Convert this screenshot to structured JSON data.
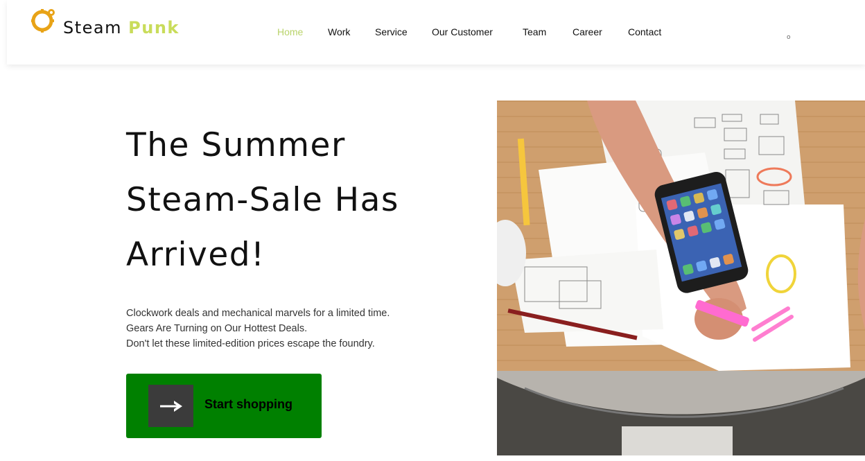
{
  "brand": {
    "name_part1": "Steam",
    "name_part2": "Punk",
    "logo_icon": "gear-icon",
    "accent_color": "#c9dc5a"
  },
  "nav": {
    "items": [
      {
        "label": "Home",
        "active": true
      },
      {
        "label": "Work",
        "active": false
      },
      {
        "label": "Service",
        "active": false
      },
      {
        "label": "Our Customer",
        "active": false
      },
      {
        "label": "Team",
        "active": false
      },
      {
        "label": "Career",
        "active": false
      },
      {
        "label": "Contact",
        "active": false
      }
    ],
    "active_color": "#b9d36a"
  },
  "header_extra": {
    "dot": "o"
  },
  "hero": {
    "title_lines": [
      "The Summer",
      "Steam-Sale Has",
      "Arrived!"
    ],
    "subtitle_lines": [
      "Clockwork deals and mechanical marvels for a limited time.",
      "Gears Are Turning on Our Hottest Deals.",
      "Don't let these limited-edition prices escape the foundry."
    ],
    "cta": {
      "label": "Start shopping",
      "icon": "arrow-right-icon",
      "background": "#008000"
    },
    "image_icon": "workspace-photo"
  }
}
